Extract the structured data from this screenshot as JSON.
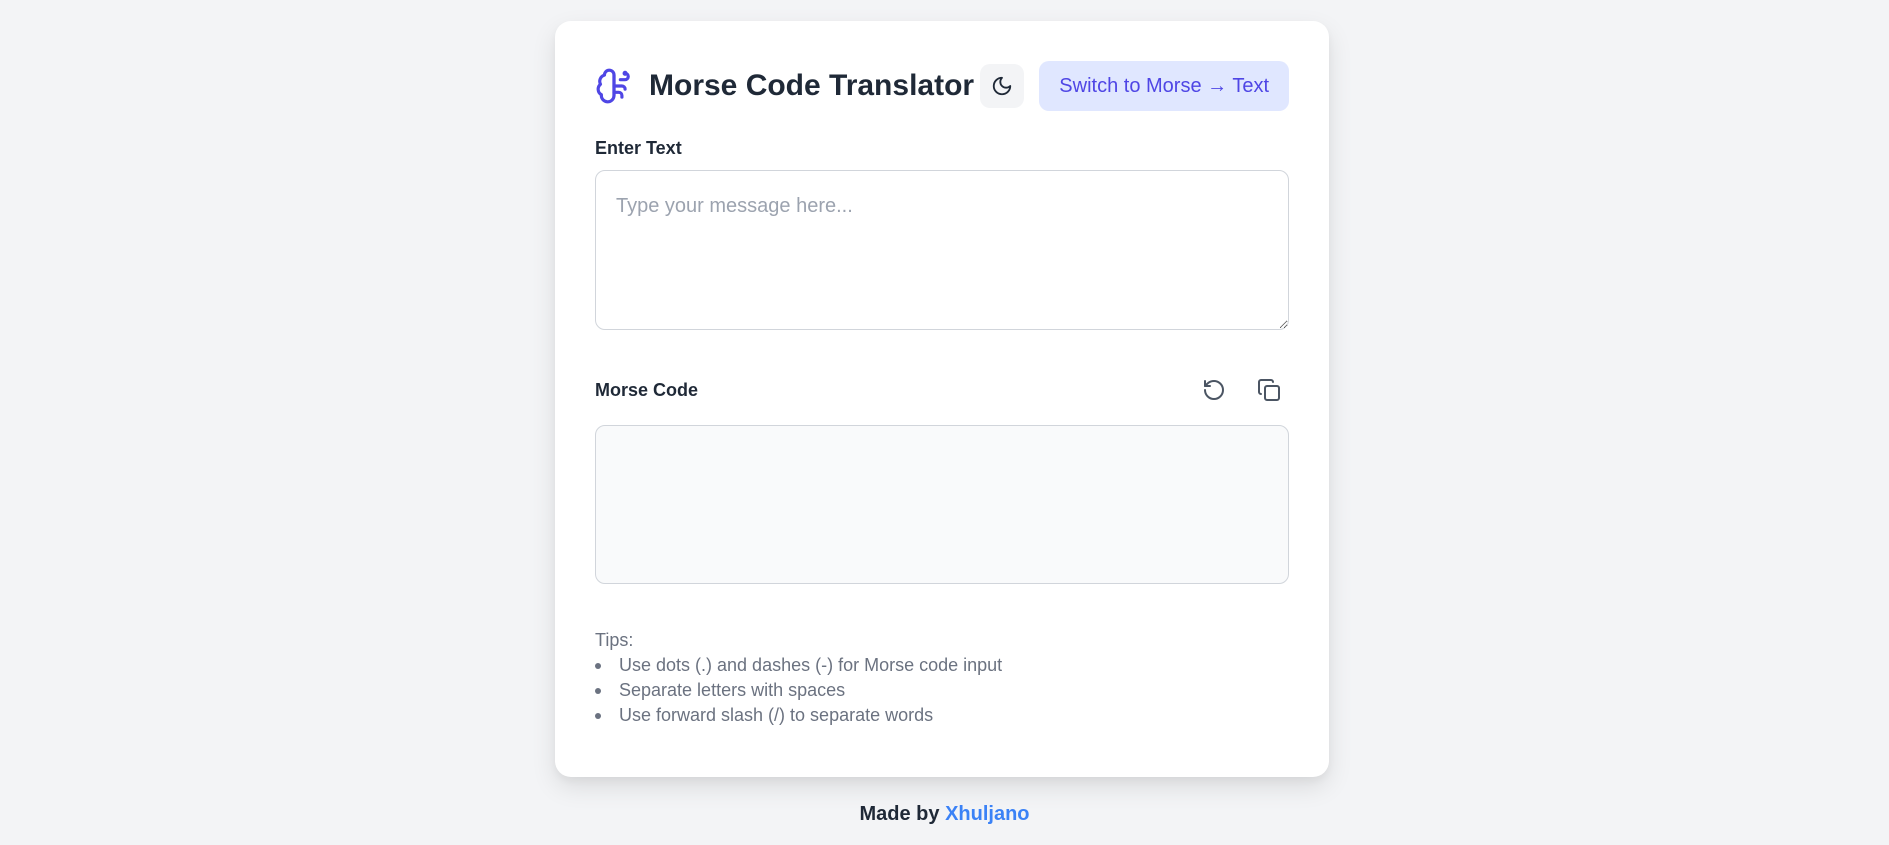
{
  "header": {
    "logo_icon": "brain-icon",
    "title": "Morse Code Translator",
    "theme_icon": "moon-icon",
    "switch_label": "Switch to Morse → Text"
  },
  "input": {
    "label": "Enter Text",
    "placeholder": "Type your message here...",
    "value": ""
  },
  "output": {
    "label": "Morse Code",
    "reset_icon": "reset-icon",
    "copy_icon": "copy-icon",
    "value": ""
  },
  "tips": {
    "title": "Tips:",
    "items": [
      "Use dots (.) and dashes (-) for Morse code input",
      "Separate letters with spaces",
      "Use forward slash (/) to separate words"
    ]
  },
  "footer": {
    "prefix": "Made by",
    "author": "Xhuljano"
  },
  "colors": {
    "accent": "#4f46e5",
    "accent_bg": "#e0e7ff",
    "link": "#3b82f6",
    "page_bg": "#f3f4f6"
  }
}
